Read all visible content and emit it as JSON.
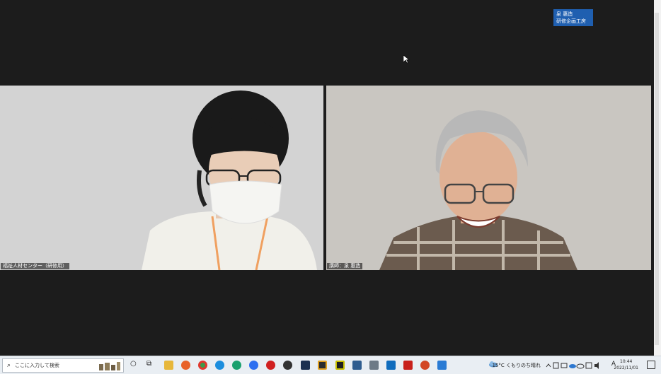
{
  "meeting": {
    "badge_line1": "泉 惠造",
    "badge_line2": "研修企画工房"
  },
  "participants": [
    {
      "label": "福祉人材センター（研修用）"
    },
    {
      "label": "講師：泉 惠造"
    }
  ],
  "taskbar": {
    "search_placeholder": "ここに入力して検索",
    "weather": "15°C くもりのち晴れ",
    "ime": "A",
    "time": "10:44",
    "date": "2022/11/01"
  },
  "colors": {
    "background": "#1c1c1c",
    "badge": "#1f5fb0",
    "taskbar": "#e9eef3"
  },
  "icons": [
    "cortana-icon",
    "task-view-icon",
    "file-explorer-icon",
    "firefox-icon",
    "chrome-icon",
    "skype-icon",
    "edge-icon",
    "zoom-icon",
    "record-icon",
    "app-icon",
    "app-icon",
    "app-icon",
    "app-icon",
    "app-icon",
    "camera-icon",
    "outlook-icon",
    "acrobat-icon",
    "powerpoint-icon",
    "photos-icon"
  ]
}
